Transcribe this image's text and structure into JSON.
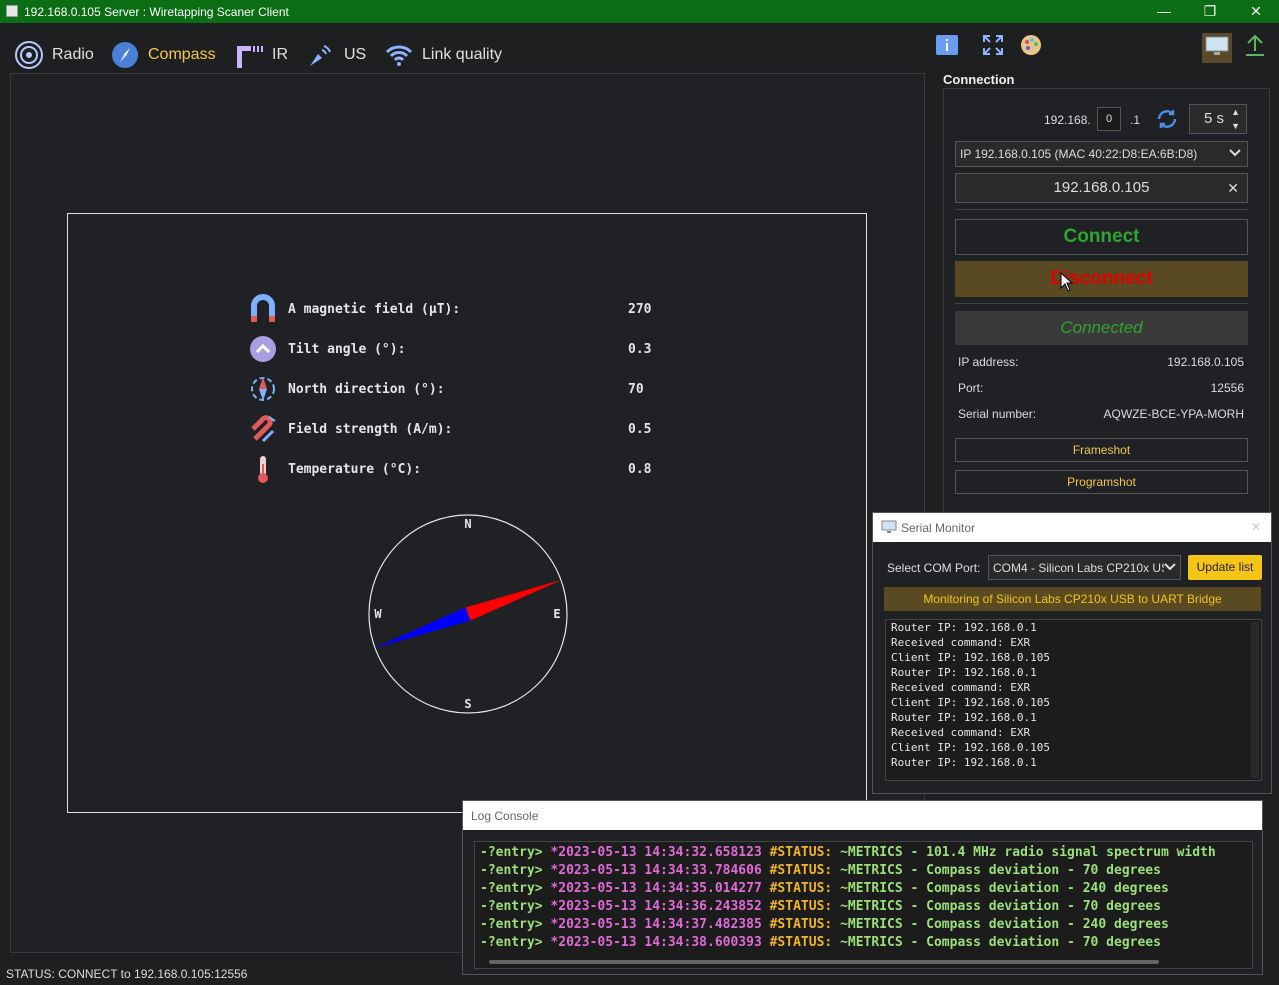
{
  "window": {
    "title": "192.168.0.105 Server : Wiretapping Scaner Client",
    "min_glyph": "—",
    "max_glyph": "❐",
    "close_glyph": "✕",
    "accent": "#0b6e15"
  },
  "tabs": [
    {
      "label": "Radio",
      "icon": "radio-icon",
      "active": false
    },
    {
      "label": "Compass",
      "icon": "compass-icon",
      "active": true
    },
    {
      "label": "IR",
      "icon": "ir-icon",
      "active": false
    },
    {
      "label": "US",
      "icon": "ultrasound-icon",
      "active": false
    },
    {
      "label": "Link quality",
      "icon": "wifi-icon",
      "active": false
    }
  ],
  "metrics": [
    {
      "label": "A magnetic field (µT):",
      "value": "270",
      "icon": "magnet-icon"
    },
    {
      "label": "Tilt angle (°):",
      "value": "0.3",
      "icon": "tilt-icon"
    },
    {
      "label": "North direction (°):",
      "value": "70",
      "icon": "north-icon"
    },
    {
      "label": "Field strength (A/m):",
      "value": "0.5",
      "icon": "field-strength-icon"
    },
    {
      "label": "Temperature (°C):",
      "value": "0.8",
      "icon": "thermometer-icon"
    }
  ],
  "compass": {
    "n": "N",
    "s": "S",
    "e": "E",
    "w": "W",
    "heading_deg": 70
  },
  "connection": {
    "title": "Connection",
    "ip_prefix": "192.168.",
    "ip_octet": "0",
    "ip_suffix": ".1",
    "interval": "5 s",
    "device_select": "IP 192.168.0.105 (MAC 40:22:D8:EA:6B:D8)",
    "ip_input": "192.168.0.105",
    "connect_label": "Connect",
    "disconnect_label": "Disconnect",
    "connected_label": "Connected",
    "ip_key": "IP address:",
    "ip_val": "192.168.0.105",
    "port_key": "Port:",
    "port_val": "12556",
    "serial_key": "Serial number:",
    "serial_val": "AQWZE-BCE-YPA-MORH",
    "frameshot_label": "Frameshot",
    "programshot_label": "Programshot"
  },
  "serial_monitor": {
    "title": "Serial Monitor",
    "com_label": "Select COM Port:",
    "com_value": "COM4 - Silicon Labs CP210x US",
    "update_label": "Update list",
    "monitoring_label": "Monitoring of Silicon Labs CP210x USB to UART Bridge",
    "lines": [
      "Router IP: 192.168.0.1",
      "Received command: EXR",
      "Client IP: 192.168.0.105",
      "Router IP: 192.168.0.1",
      "Received command: EXR",
      "Client IP: 192.168.0.105",
      "Router IP: 192.168.0.1",
      "Received command: EXR",
      "Client IP: 192.168.0.105",
      "Router IP: 192.168.0.1"
    ]
  },
  "log_console": {
    "title": "Log Console",
    "entries": [
      {
        "prefix": "-?entry>",
        "time": "*2023-05-13 14:34:32.658123",
        "status": "#STATUS:",
        "msg": "~METRICS - 101.4 MHz radio signal spectrum width"
      },
      {
        "prefix": "-?entry>",
        "time": "*2023-05-13 14:34:33.784606",
        "status": "#STATUS:",
        "msg": "~METRICS - Compass deviation - 70 degrees"
      },
      {
        "prefix": "-?entry>",
        "time": "*2023-05-13 14:34:35.014277",
        "status": "#STATUS:",
        "msg": "~METRICS - Compass deviation - 240 degrees"
      },
      {
        "prefix": "-?entry>",
        "time": "*2023-05-13 14:34:36.243852",
        "status": "#STATUS:",
        "msg": "~METRICS - Compass deviation - 70 degrees"
      },
      {
        "prefix": "-?entry>",
        "time": "*2023-05-13 14:34:37.482385",
        "status": "#STATUS:",
        "msg": "~METRICS - Compass deviation - 240 degrees"
      },
      {
        "prefix": "-?entry>",
        "time": "*2023-05-13 14:34:38.600393",
        "status": "#STATUS:",
        "msg": "~METRICS - Compass deviation - 70 degrees"
      }
    ]
  },
  "status_bar": "STATUS: CONNECT to 192.168.0.105:12556"
}
